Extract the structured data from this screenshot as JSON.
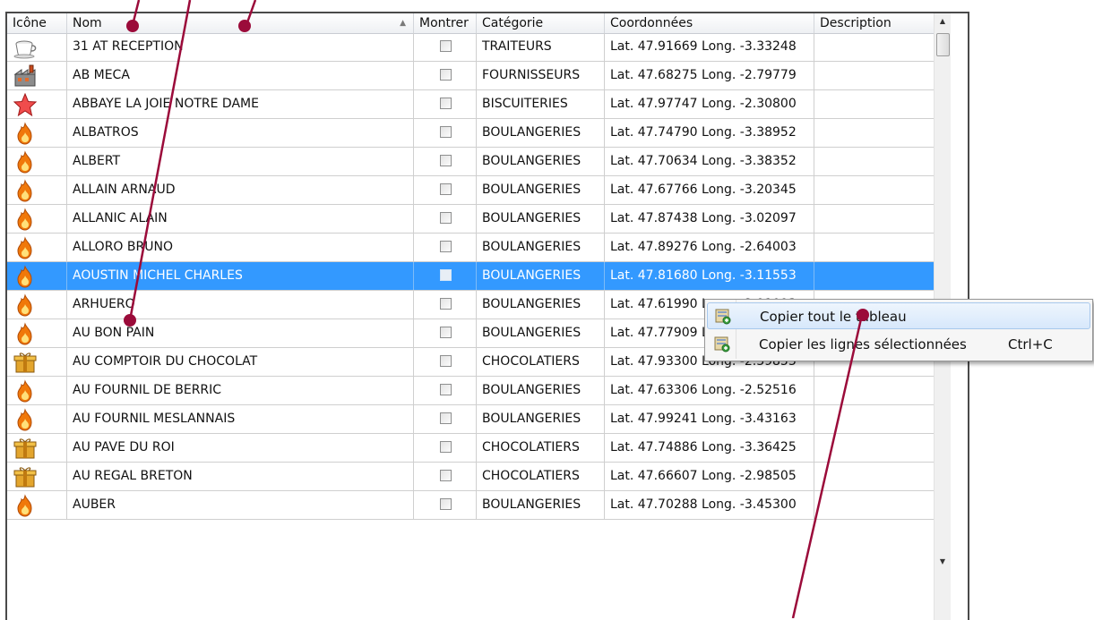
{
  "columns": {
    "icon": "Icône",
    "name": "Nom",
    "show": "Montrer",
    "category": "Catégorie",
    "coords": "Coordonnées",
    "description": "Description"
  },
  "rows": [
    {
      "icon": "coffee-cup-icon",
      "name": "31 AT RECEPTION",
      "category": "TRAITEURS",
      "coords": "Lat. 47.91669 Long. -3.33248",
      "description": "",
      "shown": false
    },
    {
      "icon": "factory-icon",
      "name": "AB MECA",
      "category": "FOURNISSEURS",
      "coords": "Lat. 47.68275 Long. -2.79779",
      "description": "",
      "shown": false
    },
    {
      "icon": "star-icon",
      "name": "ABBAYE LA JOIE NOTRE DAME",
      "category": "BISCUITERIES",
      "coords": "Lat. 47.97747 Long. -2.30800",
      "description": "",
      "shown": false
    },
    {
      "icon": "flame-icon",
      "name": "ALBATROS",
      "category": "BOULANGERIES",
      "coords": "Lat. 47.74790 Long. -3.38952",
      "description": "",
      "shown": false
    },
    {
      "icon": "flame-icon",
      "name": "ALBERT",
      "category": "BOULANGERIES",
      "coords": "Lat. 47.70634 Long. -3.38352",
      "description": "",
      "shown": false
    },
    {
      "icon": "flame-icon",
      "name": "ALLAIN ARNAUD",
      "category": "BOULANGERIES",
      "coords": "Lat. 47.67766 Long. -3.20345",
      "description": "",
      "shown": false
    },
    {
      "icon": "flame-icon",
      "name": "ALLANIC ALAIN",
      "category": "BOULANGERIES",
      "coords": "Lat. 47.87438 Long. -3.02097",
      "description": "",
      "shown": false
    },
    {
      "icon": "flame-icon",
      "name": "ALLORO BRUNO",
      "category": "BOULANGERIES",
      "coords": "Lat. 47.89276 Long. -2.64003",
      "description": "",
      "shown": false
    },
    {
      "icon": "flame-icon",
      "name": "AOUSTIN MICHEL CHARLES",
      "category": "BOULANGERIES",
      "coords": "Lat. 47.81680 Long. -3.11553",
      "description": "",
      "shown": false,
      "selected": true
    },
    {
      "icon": "flame-icon",
      "name": "ARHUERO",
      "category": "BOULANGERIES",
      "coords": "Lat. 47.61990 Long. -2.91093",
      "description": "",
      "shown": false
    },
    {
      "icon": "flame-icon",
      "name": "AU BON PAIN",
      "category": "BOULANGERIES",
      "coords": "Lat. 47.77909 Long. -2.69229",
      "description": "",
      "shown": false
    },
    {
      "icon": "gift-box-icon",
      "name": "AU COMPTOIR DU CHOCOLAT",
      "category": "CHOCOLATIERS",
      "coords": "Lat. 47.93300 Long. -2.39853",
      "description": "",
      "shown": false
    },
    {
      "icon": "flame-icon",
      "name": "AU FOURNIL DE BERRIC",
      "category": "BOULANGERIES",
      "coords": "Lat. 47.63306 Long. -2.52516",
      "description": "",
      "shown": false
    },
    {
      "icon": "flame-icon",
      "name": "AU FOURNIL MESLANNAIS",
      "category": "BOULANGERIES",
      "coords": "Lat. 47.99241 Long. -3.43163",
      "description": "",
      "shown": false
    },
    {
      "icon": "gift-box-icon",
      "name": "AU PAVE DU ROI",
      "category": "CHOCOLATIERS",
      "coords": "Lat. 47.74886 Long. -3.36425",
      "description": "",
      "shown": false
    },
    {
      "icon": "gift-box-icon",
      "name": "AU REGAL BRETON",
      "category": "CHOCOLATIERS",
      "coords": "Lat. 47.66607 Long. -2.98505",
      "description": "",
      "shown": false
    },
    {
      "icon": "flame-icon",
      "name": "AUBER",
      "category": "BOULANGERIES",
      "coords": "Lat. 47.70288 Long. -3.45300",
      "description": "",
      "shown": false
    }
  ],
  "context_menu": {
    "items": [
      {
        "label": "Copier tout le tableau",
        "shortcut": "",
        "icon": "copy-table-icon",
        "highlighted": true
      },
      {
        "label": "Copier les lignes sélectionnées",
        "shortcut": "Ctrl+C",
        "icon": "copy-rows-icon",
        "highlighted": false
      }
    ]
  },
  "colors": {
    "selection": "#3399ff",
    "callout": "#9b0b3a"
  }
}
